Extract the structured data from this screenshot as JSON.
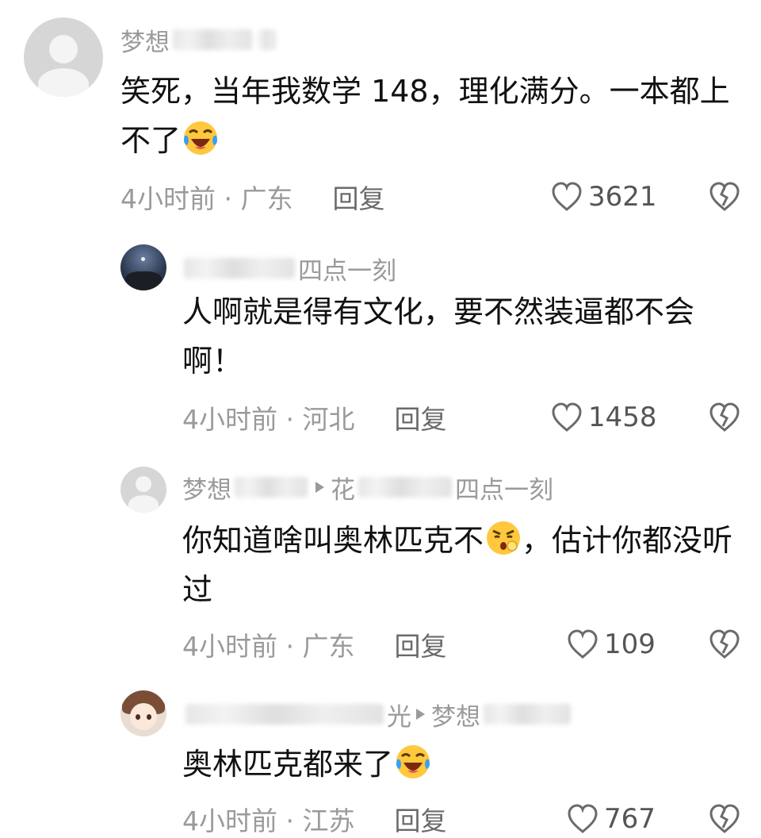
{
  "comments": [
    {
      "username": "梦想",
      "text": "笑死，当年我数学 148，理化满分。一本都上不了",
      "emoji": "laughing-crying-emoji",
      "time": "4小时前 · 广东",
      "reply_label": "回复",
      "likes": "3621"
    },
    {
      "username_tail": "四点一刻",
      "text": "人啊就是得有文化，要不然装逼都不会啊！",
      "time": "4小时前 · 河北",
      "reply_label": "回复",
      "likes": "1458"
    },
    {
      "username": "梦想",
      "reply_to_prefix": "花",
      "reply_to_tail": "四点一刻",
      "text_before": "你知道啥叫奥林匹克不",
      "emoji": "pouting-emoji",
      "text_after": "，估计你都没听过",
      "time": "4小时前 · 广东",
      "reply_label": "回复",
      "likes": "109"
    },
    {
      "username_tail": "光",
      "reply_to": "梦想",
      "text": "奥林匹克都来了",
      "emoji": "laughing-crying-emoji",
      "time": "4小时前 · 江苏",
      "reply_label": "回复",
      "likes": "767"
    }
  ],
  "colors": {
    "meta": "#9a9a9a",
    "text": "#111111",
    "emoji_yellow": "#ffc83d",
    "emoji_tears": "#3aa0f0"
  }
}
